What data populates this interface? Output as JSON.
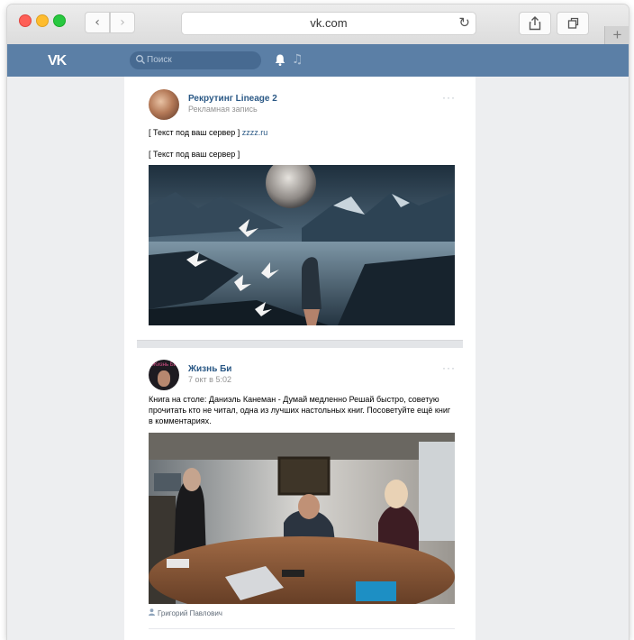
{
  "browser": {
    "url": "vk.com",
    "back_glyph": "‹",
    "forward_glyph": "›",
    "reload_glyph": "↻",
    "new_tab_glyph": "+"
  },
  "vk_header": {
    "logo_text": "VK",
    "search_placeholder": "Поиск",
    "music_glyph": "♫",
    "brand_color": "#5b7fa6"
  },
  "posts": [
    {
      "author": "Рекрутинг Lineage 2",
      "subtitle": "Рекламная запись",
      "more_glyph": "···",
      "text_line1_prefix": "[ Текст под ваш сервер ] ",
      "text_line1_link": "zzzz.ru",
      "text_line2": "[ Текст под ваш сервер ]"
    },
    {
      "author": "Жизнь Би",
      "subtitle": "7 окт в 5:02",
      "more_glyph": "···",
      "avatar_text": "Жизнь Би",
      "text": "Книга на столе: Даниэль Канеман - Думай медленно Решай быстро, советую прочитать кто не читал, одна из лучших настольных книг. Посоветуйте ещё книг в комментариях.",
      "photo_caption": "Григорий Павлович"
    }
  ]
}
